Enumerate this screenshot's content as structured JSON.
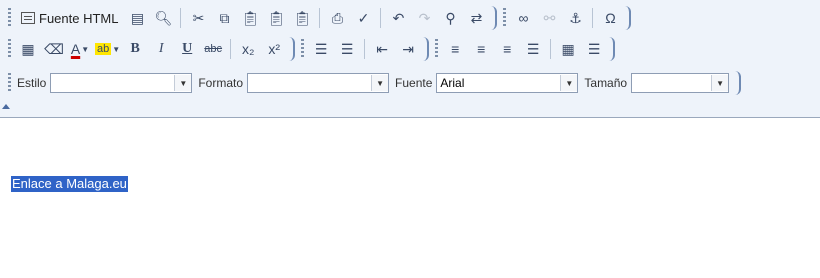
{
  "toolbar": {
    "row1": {
      "source_label": "Fuente HTML"
    },
    "row2": {
      "bold": "B",
      "italic": "I",
      "underline": "U",
      "strike": "abc",
      "subscript": "x₂",
      "superscript": "x²",
      "text_color_glyph": "A",
      "bg_color_glyph": "ab"
    },
    "row3": {
      "style_label": "Estilo",
      "style_value": "",
      "format_label": "Formato",
      "format_value": "",
      "font_label": "Fuente",
      "font_value": "Arial",
      "size_label": "Tamaño",
      "size_value": ""
    }
  },
  "content": {
    "link_text": "Enlace a Malaga.eu"
  },
  "colors": {
    "toolbar_bg": "#eef3fa",
    "selection": "#2f63c7",
    "group_border": "#6f8ab3"
  }
}
